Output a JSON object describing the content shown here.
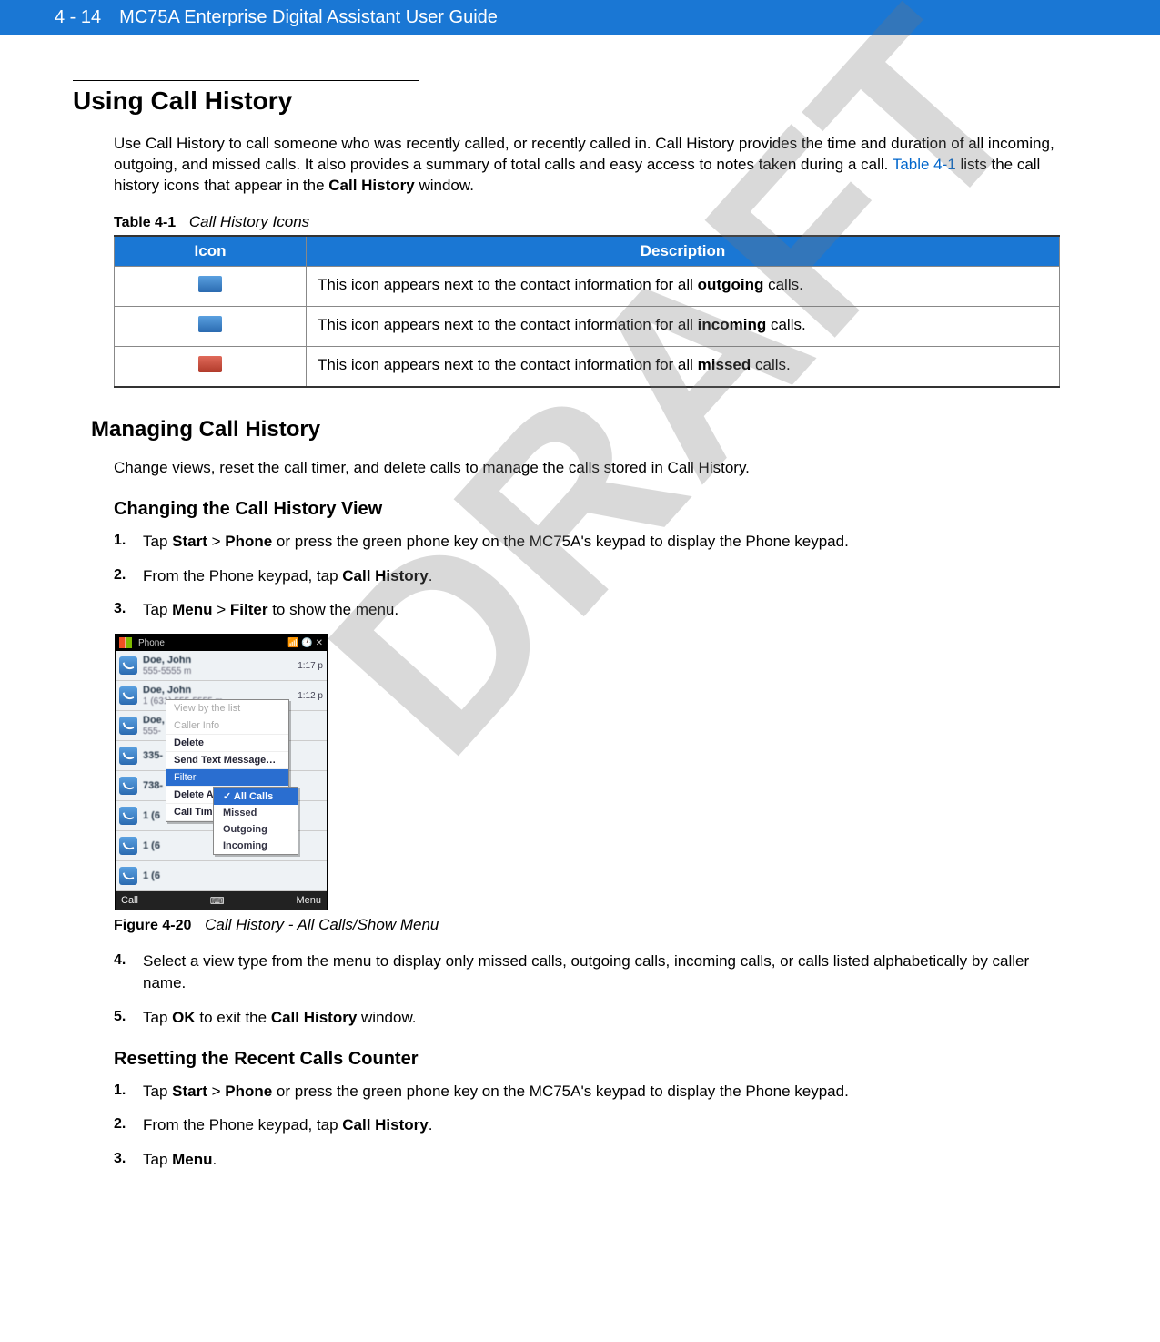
{
  "header": {
    "page_number": "4 - 14",
    "guide_title": "MC75A Enterprise Digital Assistant User Guide"
  },
  "watermark": "DRAFT",
  "section": {
    "title": "Using Call History",
    "intro_parts": {
      "p1": "Use Call History to call someone who was recently called, or recently called in. Call History provides the time and duration of all incoming, outgoing, and missed calls. It also provides a summary of total calls and easy access to notes taken during a call. ",
      "link": "Table 4-1",
      "p2": " lists the call history icons that appear in the ",
      "bold": "Call History",
      "p3": " window."
    }
  },
  "table": {
    "label": "Table 4-1",
    "caption": "Call History Icons",
    "headers": {
      "icon": "Icon",
      "description": "Description"
    },
    "rows": [
      {
        "icon_name": "outgoing-call-icon",
        "desc_pre": "This icon appears next to the contact information for all ",
        "desc_bold": "outgoing",
        "desc_post": " calls."
      },
      {
        "icon_name": "incoming-call-icon",
        "desc_pre": "This icon appears next to the contact information for all ",
        "desc_bold": "incoming",
        "desc_post": " calls."
      },
      {
        "icon_name": "missed-call-icon",
        "desc_pre": "This icon appears next to the contact information for all ",
        "desc_bold": "missed",
        "desc_post": " calls."
      }
    ]
  },
  "managing": {
    "title": "Managing Call History",
    "intro": "Change views, reset the call timer, and delete calls to manage the calls stored in Call History."
  },
  "changing_view": {
    "title": "Changing the Call History View",
    "steps": {
      "s1": {
        "t1": "Tap ",
        "b1": "Start",
        "t2": " > ",
        "b2": "Phone",
        "t3": " or press the green phone key on the MC75A's keypad to display the Phone keypad."
      },
      "s2": {
        "t1": "From the Phone keypad, tap ",
        "b1": "Call History",
        "t2": "."
      },
      "s3": {
        "t1": "Tap ",
        "b1": "Menu",
        "t2": " > ",
        "b2": "Filter",
        "t3": " to show the menu."
      },
      "s4": {
        "t1": "Select a view type from the menu to display only missed calls, outgoing calls, incoming calls, or calls listed alphabetically by caller name."
      },
      "s5": {
        "t1": "Tap ",
        "b1": "OK",
        "t2": " to exit the ",
        "b2": "Call History",
        "t3": " window."
      }
    }
  },
  "figure": {
    "label": "Figure 4-20",
    "caption": "Call History - All Calls/Show Menu",
    "device": {
      "top_title": "Phone",
      "rows": [
        {
          "name": "Doe, John",
          "sub": "555-5555 m",
          "time": "1:17 p"
        },
        {
          "name": "Doe, John",
          "sub": "1 (631) 555-5555 m",
          "time": "1:12 p"
        },
        {
          "name": "Doe,",
          "sub": "555-"
        },
        {
          "name": "335-",
          "sub": ""
        },
        {
          "name": "738-",
          "sub": ""
        },
        {
          "name": "1 (6",
          "sub": ""
        },
        {
          "name": "1 (6",
          "sub": ""
        },
        {
          "name": "1 (6",
          "sub": ""
        }
      ],
      "bottom_left": "Call",
      "bottom_right": "Menu",
      "context_menu": [
        "View by the list",
        "Caller Info",
        "Delete",
        "Send Text Message…",
        "Filter",
        "Delete All Calls",
        "Call Timers…"
      ],
      "context_menu_highlight_index": 4,
      "submenu": [
        "All Calls",
        "Missed",
        "Outgoing",
        "Incoming"
      ],
      "submenu_selected_index": 0
    }
  },
  "resetting": {
    "title": "Resetting the Recent Calls Counter",
    "steps": {
      "s1": {
        "t1": "Tap ",
        "b1": "Start",
        "t2": " > ",
        "b2": "Phone",
        "t3": " or press the green phone key on the MC75A's keypad to display the Phone keypad."
      },
      "s2": {
        "t1": "From the Phone keypad, tap ",
        "b1": "Call History",
        "t2": "."
      },
      "s3": {
        "t1": "Tap ",
        "b1": "Menu",
        "t2": "."
      }
    }
  }
}
